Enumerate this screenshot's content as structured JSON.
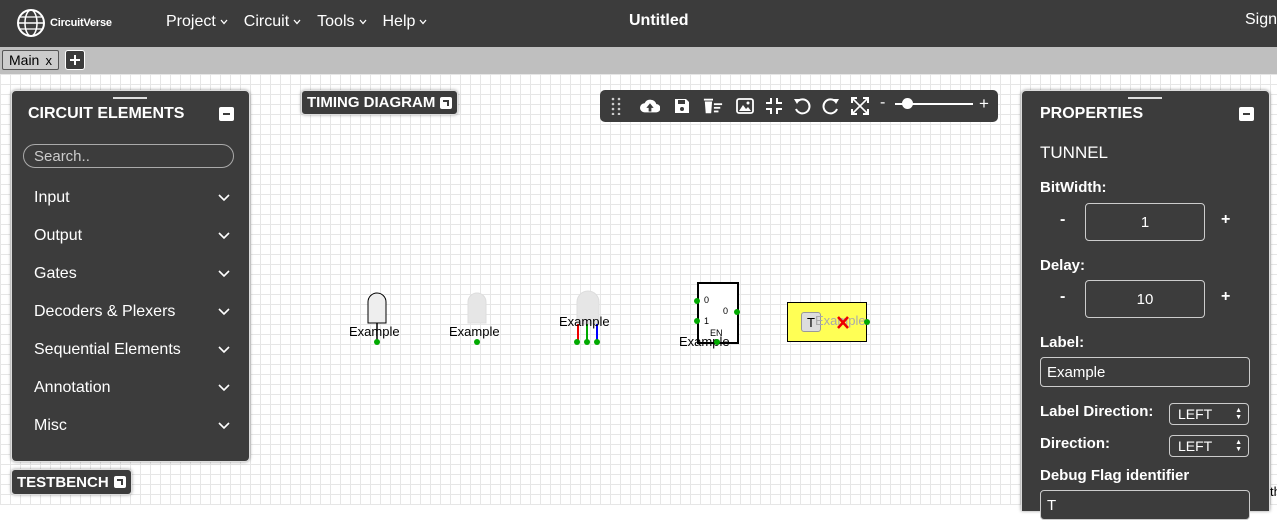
{
  "navbar": {
    "logo_text": "CircuitVerse",
    "menu": [
      {
        "label": "Project"
      },
      {
        "label": "Circuit"
      },
      {
        "label": "Tools"
      },
      {
        "label": "Help"
      }
    ],
    "project_title": "Untitled",
    "sign_in_label": "Sign"
  },
  "tabs": {
    "items": [
      {
        "label": "Main",
        "close": "x"
      }
    ],
    "add_label": "+"
  },
  "elements_panel": {
    "title": "CIRCUIT ELEMENTS",
    "search_placeholder": "Search..",
    "categories": [
      {
        "label": "Input"
      },
      {
        "label": "Output"
      },
      {
        "label": "Gates"
      },
      {
        "label": "Decoders & Plexers"
      },
      {
        "label": "Sequential Elements"
      },
      {
        "label": "Annotation"
      },
      {
        "label": "Misc"
      }
    ]
  },
  "timing_diagram": {
    "label": "TIMING DIAGRAM"
  },
  "testbench": {
    "label": "TESTBENCH"
  },
  "toolbar": {
    "zoom_minus": "-",
    "zoom_plus": "+",
    "zoom_level": 0.15
  },
  "canvas": {
    "components": [
      {
        "label": "Example"
      },
      {
        "label": "Example"
      },
      {
        "label": "Example"
      },
      {
        "label": "Example",
        "pins": {
          "in0": "0",
          "in1": "1",
          "out": "0",
          "en": "EN"
        }
      },
      {
        "label": "Example",
        "prefix": "T"
      }
    ],
    "side_text": "th"
  },
  "properties_panel": {
    "title": "PROPERTIES",
    "element_name": "TUNNEL",
    "bitwidth": {
      "label": "BitWidth:",
      "value": "1",
      "minus": "-",
      "plus": "+"
    },
    "delay": {
      "label": "Delay:",
      "value": "10",
      "minus": "-",
      "plus": "+"
    },
    "label": {
      "label": "Label:",
      "value": "Example"
    },
    "label_direction": {
      "label": "Label Direction:",
      "value": "LEFT"
    },
    "direction": {
      "label": "Direction:",
      "value": "LEFT"
    },
    "debug_flag": {
      "label": "Debug Flag identifier",
      "value": "T"
    }
  },
  "colors": {
    "panel_bg": "#3c3c3c",
    "tabbar_bg": "#bfbfbf",
    "pin_green": "#00aa00",
    "tunnel_yellow": "#ffff55"
  }
}
